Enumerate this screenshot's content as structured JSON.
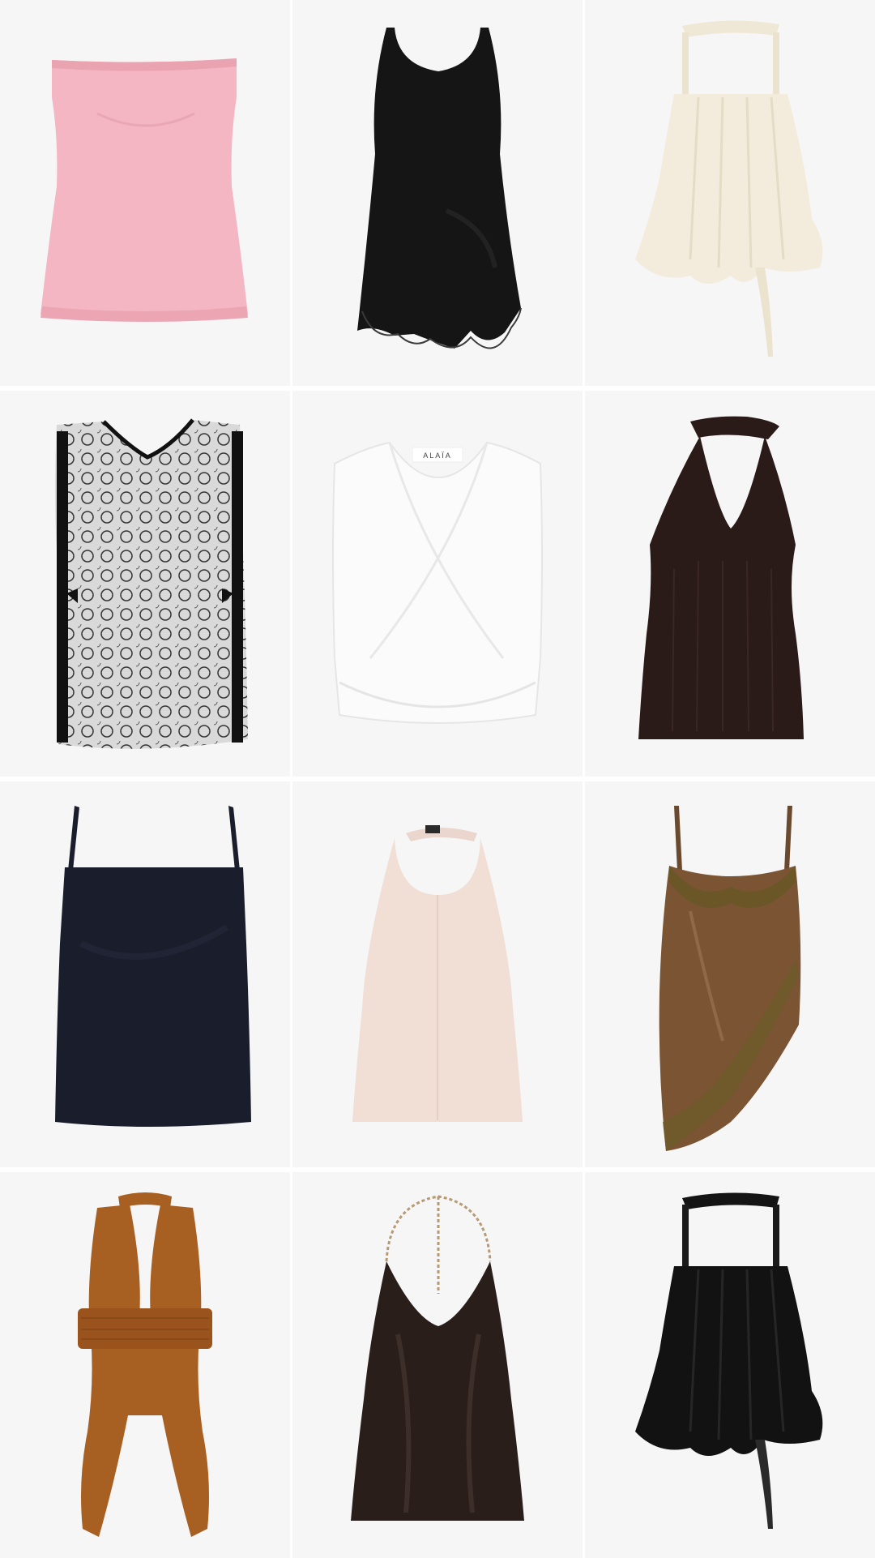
{
  "grid": {
    "columns": 3,
    "rows": 4,
    "tile_background": "#f6f6f7",
    "gap_color": "#ffffff"
  },
  "products": [
    {
      "id": 1,
      "item": "strapless-knit-top",
      "color": "#f4b6c2"
    },
    {
      "id": 2,
      "item": "lace-hem-tank",
      "color": "#151515"
    },
    {
      "id": 3,
      "item": "scarf-neck-ruffle-top",
      "color": "#f3ecdc"
    },
    {
      "id": 4,
      "item": "lace-vest-top",
      "color": "#1c1c1c"
    },
    {
      "id": 5,
      "item": "wrap-crop-top",
      "color": "#fbfbfb",
      "brand_label": "ALAÏA"
    },
    {
      "id": 6,
      "item": "ribbed-halter-top",
      "color": "#2a1a18"
    },
    {
      "id": 7,
      "item": "cami-top",
      "color": "#1a1d2b"
    },
    {
      "id": 8,
      "item": "halter-buckle-top",
      "color": "#f1dfd6"
    },
    {
      "id": 9,
      "item": "satin-lace-cami",
      "color": "#7a5433"
    },
    {
      "id": 10,
      "item": "wrap-halter-scarf-top",
      "color": "#a85f22"
    },
    {
      "id": 11,
      "item": "chain-halter-satin-top",
      "color": "#2a1e1a"
    },
    {
      "id": 12,
      "item": "scarf-neck-ruffle-top-black",
      "color": "#121212"
    }
  ]
}
